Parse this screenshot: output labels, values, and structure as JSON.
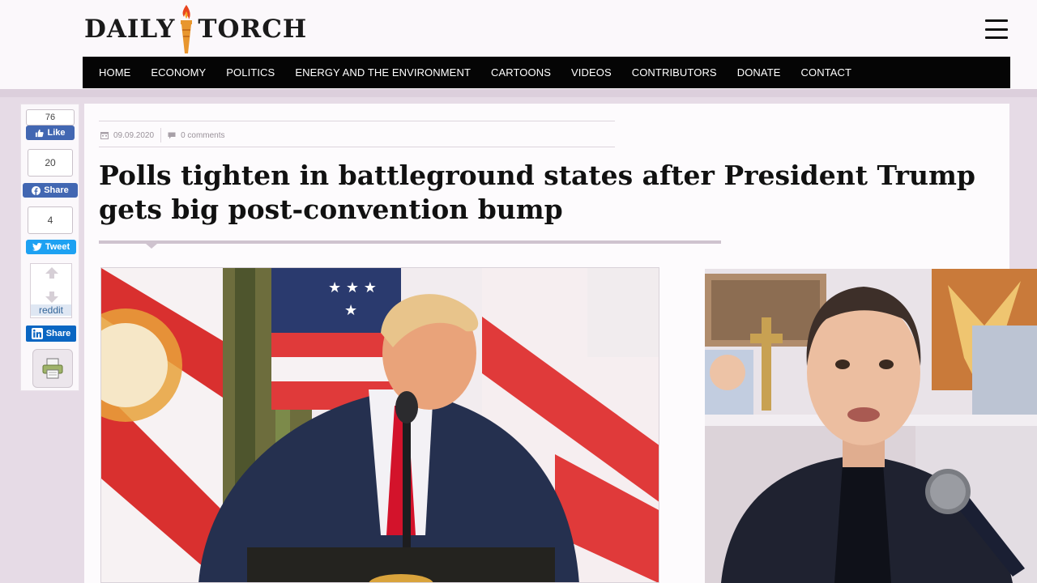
{
  "site": {
    "logo_left": "DAILY",
    "logo_right": "TORCH"
  },
  "nav": {
    "items": [
      "HOME",
      "ECONOMY",
      "POLITICS",
      "ENERGY AND THE ENVIRONMENT",
      "CARTOONS",
      "VIDEOS",
      "CONTRIBUTORS",
      "DONATE",
      "CONTACT"
    ]
  },
  "share": {
    "fb_like_count": "76",
    "fb_like_label": "Like",
    "fb_share_count": "20",
    "fb_share_label": "Share",
    "tweet_count": "4",
    "tweet_label": "Tweet",
    "reddit_label": "reddit",
    "linkedin_label": "Share"
  },
  "article": {
    "date": "09.09.2020",
    "comments": "0 comments",
    "title": "Polls tighten in battleground states after President Trump gets big post-convention bump"
  },
  "icons": {
    "menu": "hamburger-icon",
    "calendar": "calendar-icon",
    "comment": "comment-icon",
    "print": "printer-icon"
  }
}
